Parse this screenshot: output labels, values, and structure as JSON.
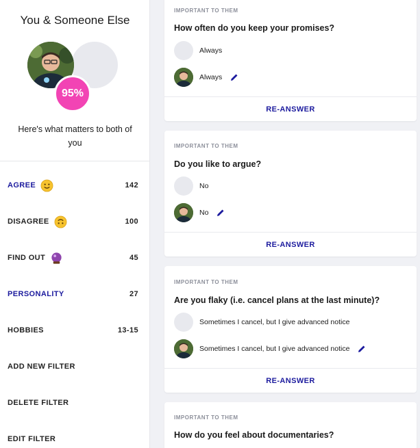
{
  "sidebar": {
    "title": "You & Someone Else",
    "match_percent": "95%",
    "matters_text": "Here's what matters to both of you",
    "filters": [
      {
        "label": "AGREE",
        "count": "142",
        "icon": "smile-emoji-icon",
        "active": true
      },
      {
        "label": "DISAGREE",
        "count": "100",
        "icon": "upside-down-face-emoji-icon",
        "active": false
      },
      {
        "label": "FIND OUT",
        "count": "45",
        "icon": "crystal-ball-emoji-icon",
        "active": false
      },
      {
        "label": "PERSONALITY",
        "count": "27",
        "active": true
      },
      {
        "label": "HOBBIES",
        "count": "13-15",
        "active": false
      },
      {
        "label": "ADD NEW FILTER",
        "count": "",
        "active": false
      },
      {
        "label": "DELETE FILTER",
        "count": "",
        "active": false
      },
      {
        "label": "EDIT FILTER",
        "count": "",
        "active": false
      }
    ]
  },
  "questions": [
    {
      "tag": "IMPORTANT TO THEM",
      "question": "How often do you keep your promises?",
      "their_answer": "Always",
      "my_answer": "Always",
      "action": "RE-ANSWER"
    },
    {
      "tag": "IMPORTANT TO THEM",
      "question": "Do you like to argue?",
      "their_answer": "No",
      "my_answer": "No",
      "action": "RE-ANSWER"
    },
    {
      "tag": "IMPORTANT TO THEM",
      "question": "Are you flaky (i.e. cancel plans at the last minute)?",
      "their_answer": "Sometimes I cancel, but I give advanced notice",
      "my_answer": "Sometimes I cancel, but I give advanced notice",
      "action": "RE-ANSWER"
    },
    {
      "tag": "IMPORTANT TO THEM",
      "question": "How do you feel about documentaries?"
    }
  ],
  "colors": {
    "accent": "#1c1b9e",
    "match_badge": "#f244b4",
    "background": "#f0f1f5"
  }
}
